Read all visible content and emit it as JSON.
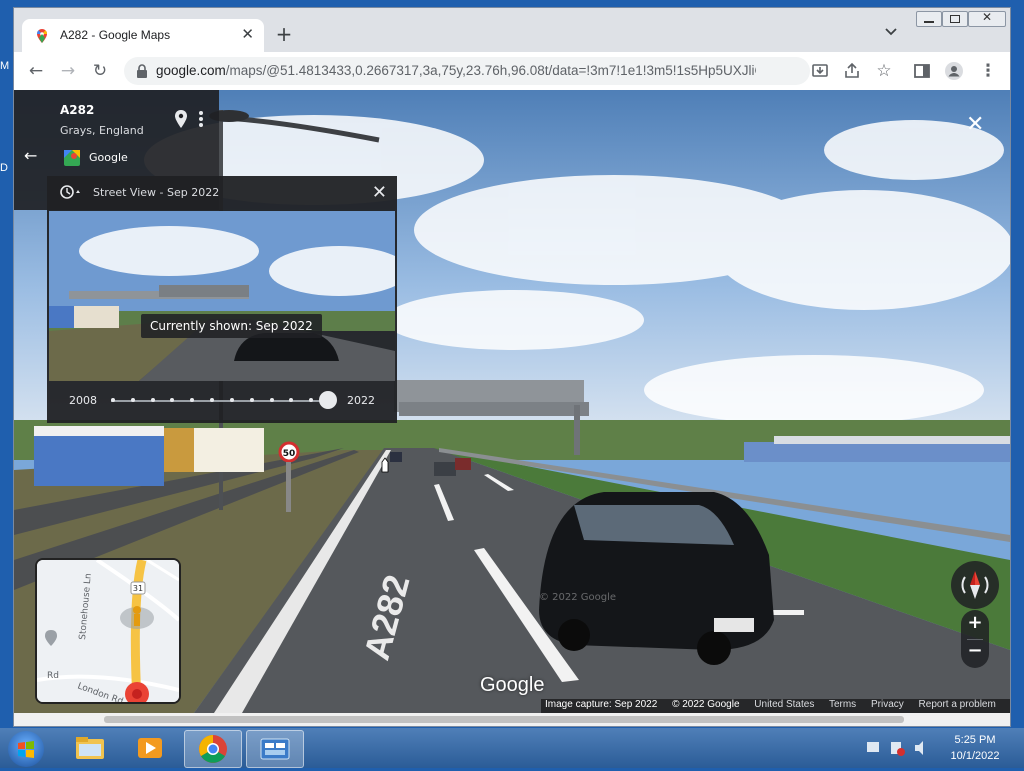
{
  "desktop": {
    "fragments": [
      "M",
      "D"
    ]
  },
  "browser": {
    "tab_title": "A282 - Google Maps",
    "url_host": "google.com",
    "url_path": "/maps/@51.4813433,0.2667317,3a,75y,23.76h,96.08t/data=!3m7!1e1!3m5!1s5Hp5UXJliGlQ..."
  },
  "place_card": {
    "name": "A282",
    "location": "Grays, England",
    "provider": "Google"
  },
  "time_machine": {
    "header": "Street View - Sep 2022",
    "current_badge": "Currently shown: Sep 2022",
    "start_year": "2008",
    "end_year": "2022",
    "capture_count": 12,
    "selected_index": 11
  },
  "scene": {
    "road_label": "A282",
    "speed_sign": "50",
    "watermark": "© 2022 Google"
  },
  "google_logo": "Google",
  "minimap": {
    "roads": [
      "Stonehouse Ln",
      "London Rd",
      "Rd"
    ],
    "shield": "31"
  },
  "footer": {
    "capture": "Image capture: Sep 2022",
    "copyright": "© 2022 Google",
    "region": "United States",
    "terms": "Terms",
    "privacy": "Privacy",
    "report": "Report a problem"
  },
  "zoom": {
    "plus": "+",
    "minus": "−"
  },
  "taskbar": {
    "time": "5:25 PM",
    "date": "10/1/2022"
  },
  "colors": {
    "sky": "#7aa7d9",
    "road": "#5b5e62",
    "card": "#202124",
    "accent_red": "#ea4335"
  }
}
